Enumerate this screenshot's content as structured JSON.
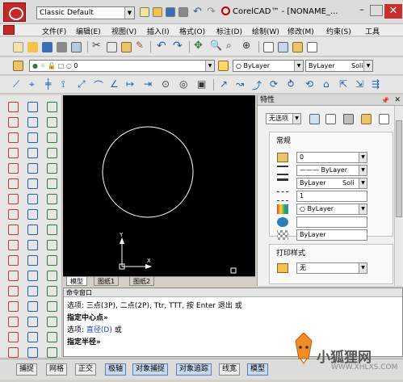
{
  "titlebar": {
    "workspace": "Classic Default",
    "title": "CorelCAD™ - [NONAME_..."
  },
  "menu": [
    "文件(F)",
    "编辑(E)",
    "视图(V)",
    "插入(I)",
    "格式(O)",
    "标注(D)",
    "绘制(W)",
    "修改(M)",
    "约束(S)",
    "工具"
  ],
  "layers_toolbar": {
    "layer_value": "0",
    "color": "ByLayer",
    "linetype": "ByLayer",
    "lineweight": "Soli"
  },
  "layout_tabs": [
    "模型",
    "图纸1",
    "图纸2"
  ],
  "properties": {
    "title": "特性",
    "selection": "无选项",
    "section_general": "常规",
    "layer": "0",
    "linetype": "——— ByLayer",
    "lineweight": "ByLayer",
    "lineweight_style": "Soli",
    "scale": "1",
    "color": "ByLayer",
    "transparency": "ByLayer",
    "section_print": "打印样式",
    "print_style": "无"
  },
  "command_window": {
    "title": "命令窗口",
    "line1": "选项: 三点(3P), 二点(2P), Ttr, TTT, 按 Enter 退出 或",
    "line2": "指定中心点»",
    "line3_prefix": "选项: ",
    "line3_opt": "直径(D)",
    "line3_suffix": " 或",
    "line4": "指定半径»"
  },
  "statusbar": [
    "捕捉",
    "网格",
    "正交",
    "极轴",
    "对象捕捉",
    "对象追踪",
    "线宽",
    "模型"
  ],
  "watermark": {
    "text": "小狐狸网",
    "url": "WWW.XHLXS.COM"
  },
  "colors": {
    "canvas": "#000000",
    "accent": "#c62828",
    "command_blue": "#1f3fb3"
  }
}
